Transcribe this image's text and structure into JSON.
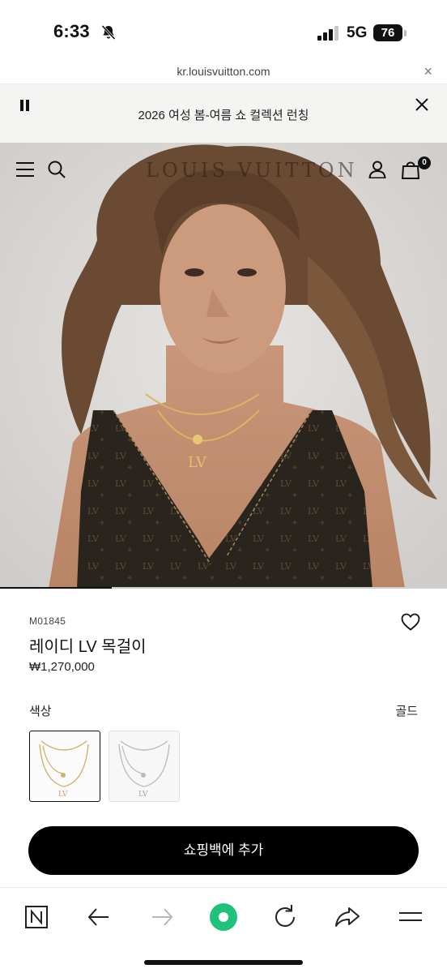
{
  "status_bar": {
    "time": "6:33",
    "network": "5G",
    "battery": "76"
  },
  "browser": {
    "url": "kr.louisvuitton.com",
    "close_symbol": "×"
  },
  "banner": {
    "text": "2026 여성 봄-여름 쇼 컬렉션 런칭"
  },
  "header": {
    "brand": "LOUIS VUITTON",
    "cart_count": "0",
    "icons": [
      "menu-icon",
      "search-icon",
      "account-icon",
      "shopping-bag-icon"
    ]
  },
  "hero": {
    "slide_progress": 0.25
  },
  "product": {
    "sku": "M01845",
    "name": "레이디 LV 목걸이",
    "price": "₩1,270,000",
    "color_label": "색상",
    "color_value": "골드",
    "add_to_bag_label": "쇼핑백에 추가"
  },
  "colors": {
    "accent": "#000000",
    "banner_bg": "#f4f4f2",
    "gold": "#c9a24a",
    "silver": "#b8bcc2",
    "browser_green": "#1ec27a"
  },
  "toolbar": {
    "icons": [
      "naver-home-icon",
      "back-arrow-icon",
      "forward-arrow-icon",
      "green-dot-icon",
      "refresh-icon",
      "share-icon",
      "menu-lines-icon"
    ]
  }
}
